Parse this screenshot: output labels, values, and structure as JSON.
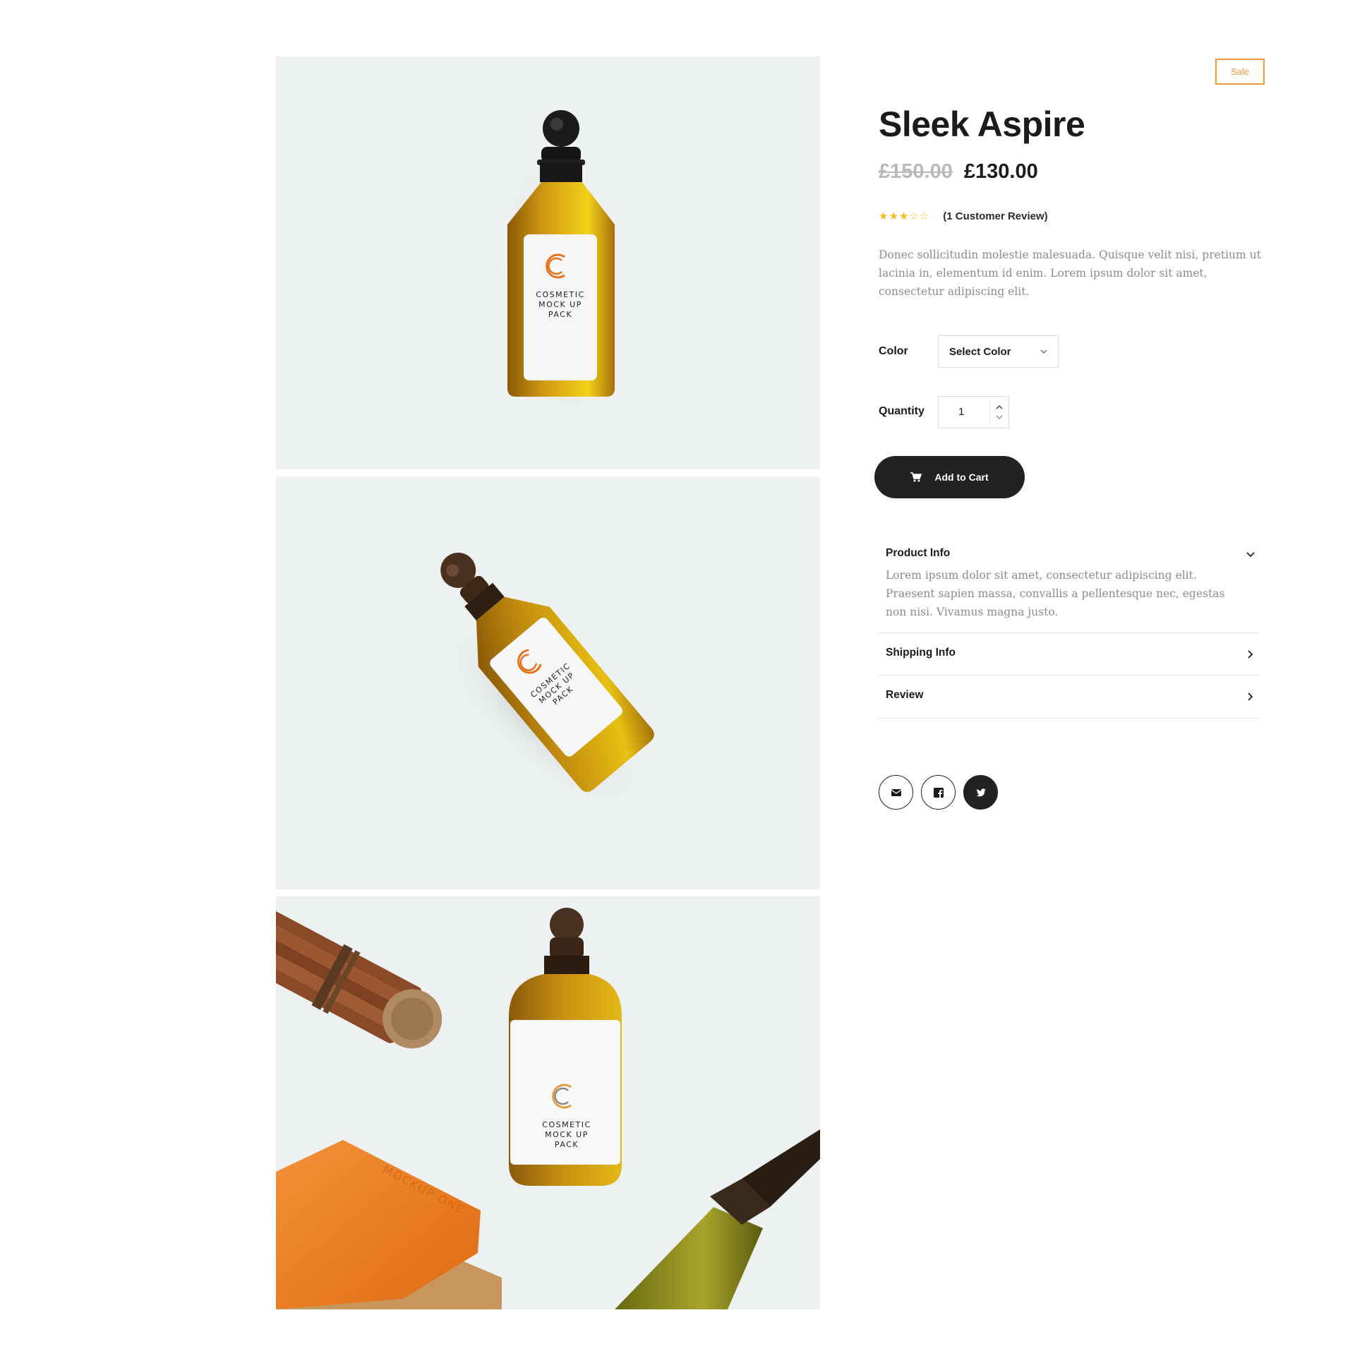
{
  "gallery": {
    "images": [
      {
        "alt": "Amber cosmetic bottle top view",
        "label_lines": [
          "COSMETIC",
          "MOCK UP",
          "PACK"
        ]
      },
      {
        "alt": "Amber cosmetic bottle lying diagonally",
        "label_lines": [
          "COSMETIC",
          "MOCK UP",
          "PACK"
        ]
      },
      {
        "alt": "Cosmetic bottle with soap and cinnamon sticks",
        "label_lines": [
          "COSMETIC",
          "MOCK UP",
          "PACK"
        ],
        "soap_text": "MOCKUP ONE"
      }
    ]
  },
  "product": {
    "badge": "Sale",
    "title": "Sleek Aspire",
    "price_old": "£150.00",
    "price_new": "£130.00",
    "rating": 3,
    "rating_max": 5,
    "review_count_text": "(1 Customer Review)",
    "description": "Donec sollicitudin molestie malesuada. Quisque velit nisi, pretium ut lacinia in, elementum id enim. Lorem ipsum dolor sit amet, consectetur adipiscing elit."
  },
  "options": {
    "color_label": "Color",
    "color_selected": "Select Color",
    "quantity_label": "Quantity",
    "quantity_value": "1"
  },
  "cart": {
    "add_label": "Add to Cart"
  },
  "accordion": {
    "items": [
      {
        "title": "Product Info",
        "expanded": true,
        "body": "Lorem ipsum dolor sit amet, consectetur adipiscing elit. Praesent sapien massa, convallis a pellentesque nec, egestas non nisi. Vivamus magna justo."
      },
      {
        "title": "Shipping Info",
        "expanded": false
      },
      {
        "title": "Review",
        "expanded": false
      }
    ]
  },
  "share": {
    "icons": [
      "mail-icon",
      "facebook-icon",
      "twitter-icon"
    ]
  },
  "colors": {
    "accent": "#f29a3a",
    "star": "#f6b915",
    "dark": "#222222",
    "muted_text": "#8c8c8c",
    "photo_bg": "#eef1f2"
  }
}
